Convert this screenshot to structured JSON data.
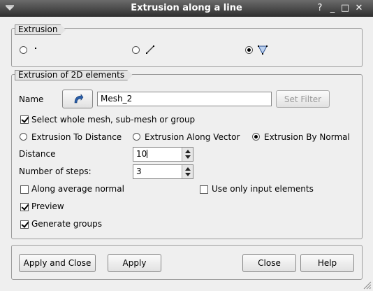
{
  "window": {
    "title": "Extrusion along a line",
    "help_glyph": "?",
    "minimize_glyph": "_",
    "maximize_glyph": "□",
    "close_glyph": "✕"
  },
  "extrusion_group": {
    "label": "Extrusion",
    "options": [
      {
        "icon": "node-icon",
        "selected": false
      },
      {
        "icon": "edge-icon",
        "selected": false
      },
      {
        "icon": "face-icon",
        "selected": true
      }
    ]
  },
  "elements_group": {
    "label": "Extrusion of 2D elements",
    "name_label": "Name",
    "name_value": "Mesh_2",
    "set_filter_label": "Set Filter",
    "select_whole_mesh_label": "Select whole mesh, sub-mesh or group",
    "select_whole_mesh_checked": true,
    "mode_to_distance": "Extrusion To Distance",
    "mode_along_vector": "Extrusion Along Vector",
    "mode_by_normal": "Extrusion By Normal",
    "selected_mode": "by_normal",
    "distance_label": "Distance",
    "distance_value": "10",
    "steps_label": "Number of steps:",
    "steps_value": "3",
    "avg_normal_label": "Along average normal",
    "avg_normal_checked": false,
    "input_only_label": "Use only input elements",
    "input_only_checked": false,
    "preview_label": "Preview",
    "preview_checked": true,
    "gen_groups_label": "Generate groups",
    "gen_groups_checked": true
  },
  "buttons": {
    "apply_close": "Apply and Close",
    "apply": "Apply",
    "close": "Close",
    "help": "Help"
  },
  "colors": {
    "title_bar": "#3b3b3b",
    "icon_blue": "#2a5ea8"
  }
}
